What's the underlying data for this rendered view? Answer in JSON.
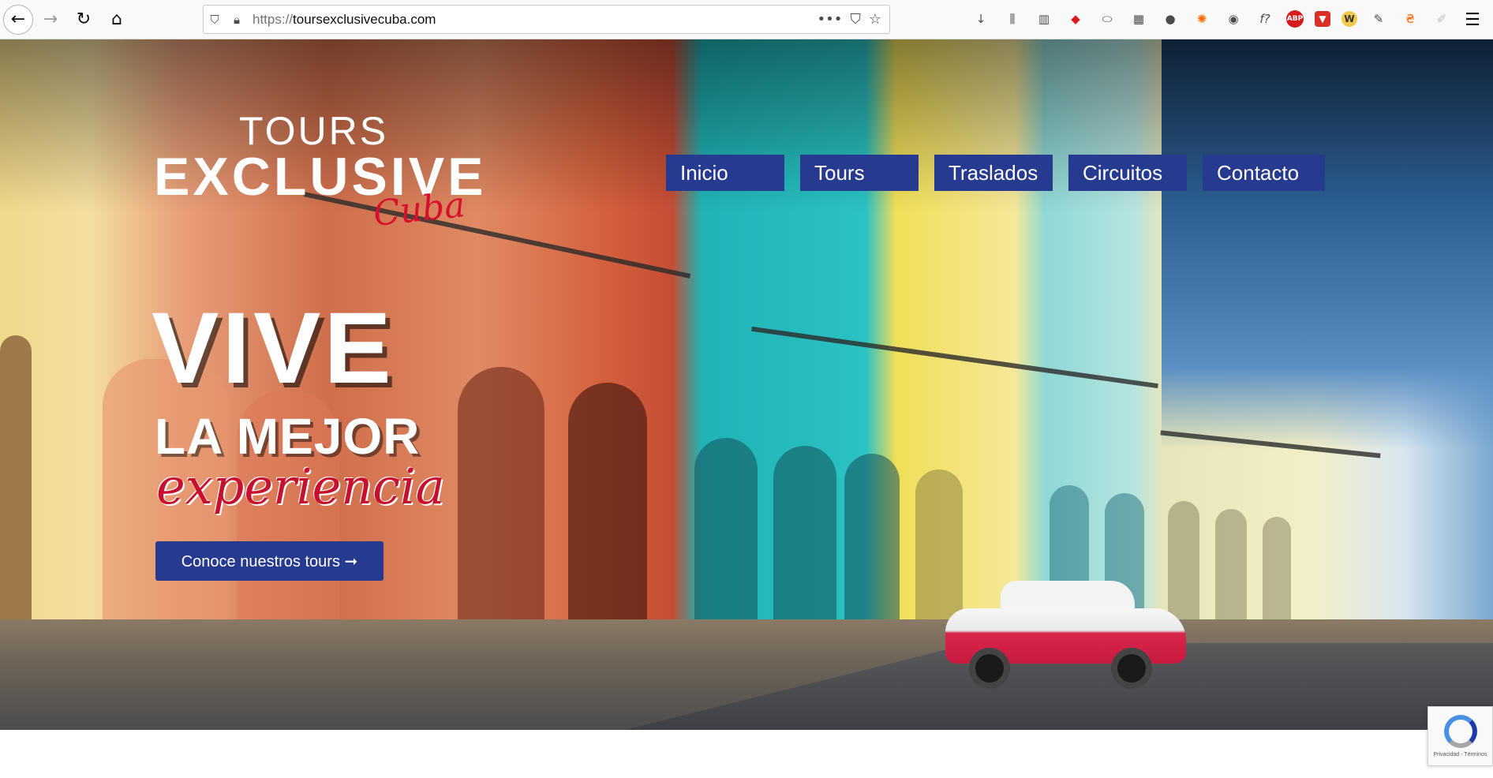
{
  "browser": {
    "url_protocol": "https://",
    "url_domain": "toursexclusivecuba.com",
    "back_icon": "arrow-left-icon",
    "forward_icon": "arrow-right-icon",
    "reload_icon": "reload-icon",
    "home_icon": "home-icon",
    "menu_dots": "•••",
    "extensions": {
      "download": "↓",
      "library": "⫼",
      "sidebar": "▥",
      "pocket": "◆",
      "disk": "⬭",
      "archive": "▦",
      "spy": "●",
      "fire": "✺",
      "account": "◉",
      "font": "f?",
      "abp": "ABP",
      "shield": "▼",
      "w": "W",
      "pen": "✎",
      "badge": "₴",
      "feather": "✐"
    }
  },
  "logo": {
    "line1": "TOURS",
    "line2": "EXCLUSIVE",
    "line3": "Cuba"
  },
  "nav": {
    "items": [
      "Inicio",
      "Tours",
      "Traslados",
      "Circuitos",
      "Contacto"
    ]
  },
  "hero": {
    "headline_1": "VIVE",
    "headline_2": "LA MEJOR",
    "headline_3": "experiencia",
    "cta_label": "Conoce nuestros tours ➞"
  },
  "recaptcha": {
    "footer": "Privacidad - Términos"
  },
  "colors": {
    "nav_blue": "#263a8f",
    "accent_red": "#c8102e"
  }
}
